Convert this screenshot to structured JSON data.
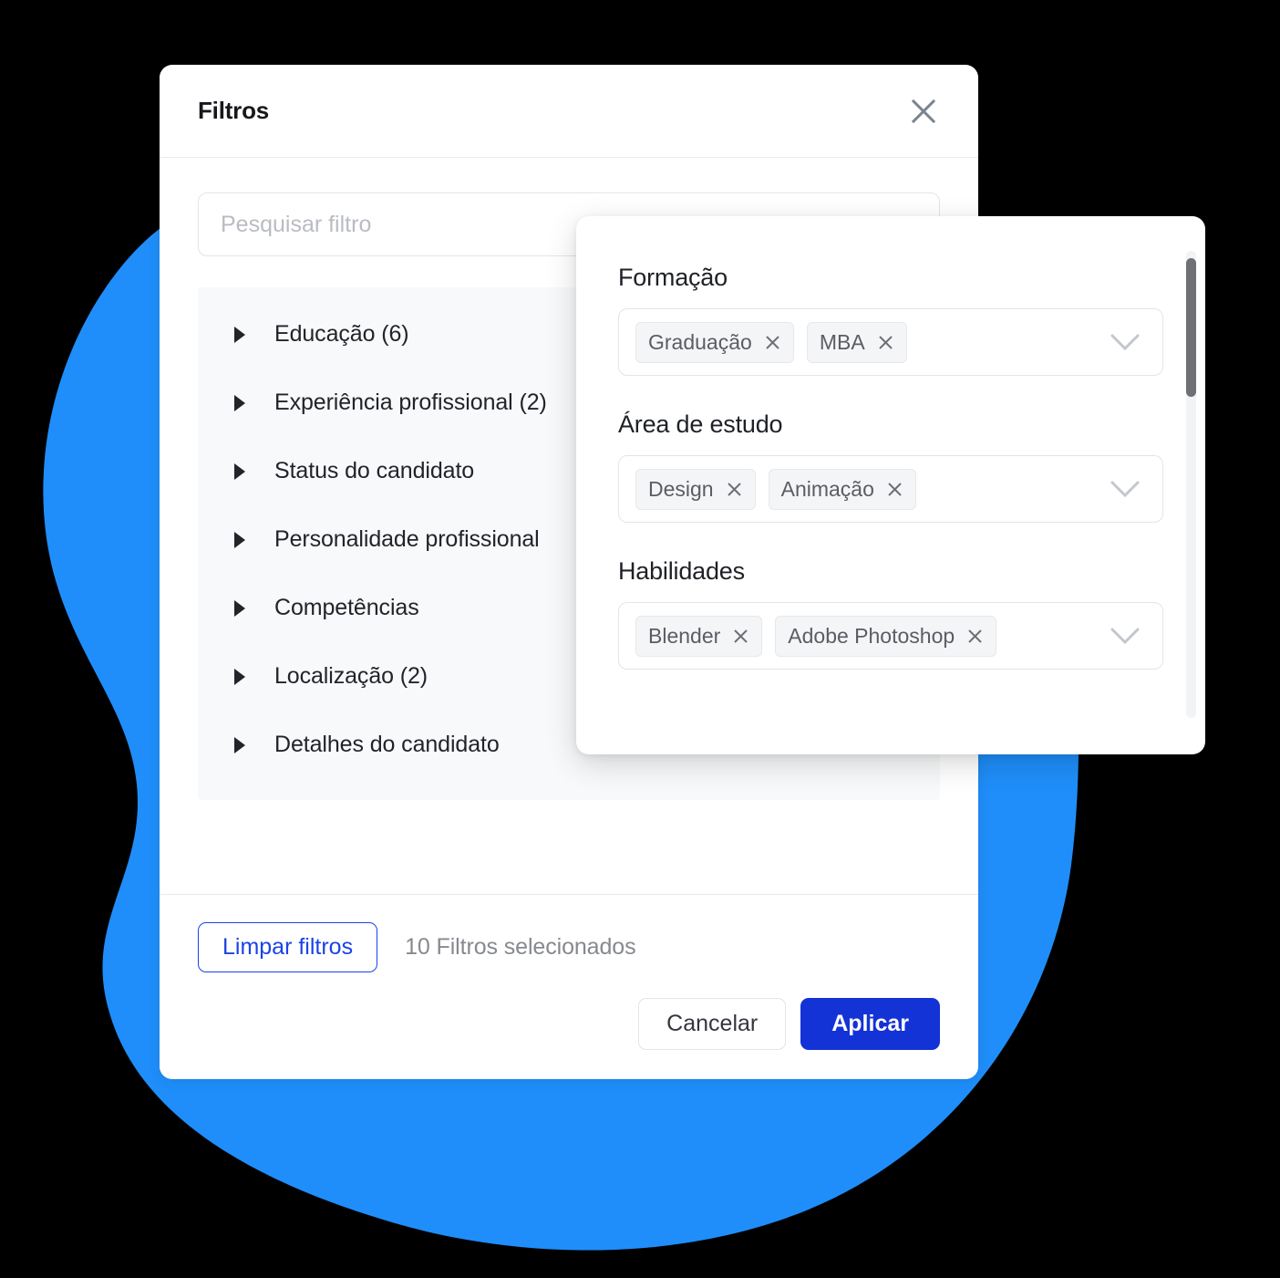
{
  "modal": {
    "title": "Filtros",
    "close_icon": "close-x-icon",
    "search": {
      "placeholder": "Pesquisar filtro",
      "value": ""
    },
    "filter_groups": [
      {
        "label": "Educação (6)",
        "caret": "caret-right-icon"
      },
      {
        "label": "Experiência profissional (2)",
        "caret": "caret-right-icon"
      },
      {
        "label": "Status do candidato",
        "caret": "caret-right-icon"
      },
      {
        "label": "Personalidade profissional",
        "caret": "caret-right-icon"
      },
      {
        "label": "Competências",
        "caret": "caret-right-icon"
      },
      {
        "label": "Localização (2)",
        "caret": "caret-right-icon"
      },
      {
        "label": "Detalhes do candidato",
        "caret": "caret-right-icon"
      }
    ],
    "footer": {
      "clear_label": "Limpar filtros",
      "selected_text": "10 Filtros selecionados",
      "cancel_label": "Cancelar",
      "apply_label": "Aplicar"
    }
  },
  "detail_panel": {
    "fields": [
      {
        "label": "Formação",
        "chips": [
          "Graduação",
          "MBA"
        ],
        "chevron": "chevron-down-icon"
      },
      {
        "label": "Área de estudo",
        "chips": [
          "Design",
          "Animação"
        ],
        "chevron": "chevron-down-icon"
      },
      {
        "label": "Habilidades",
        "chips": [
          "Blender",
          "Adobe Photoshop"
        ],
        "chevron": "chevron-down-icon"
      }
    ],
    "scrollbar": "vertical-scrollbar"
  },
  "colors": {
    "page_background": "#000000",
    "blob_blue": "#1f8efa",
    "accent_blue": "#1433d6",
    "link_blue": "#1a43e8",
    "chip_background": "#f4f5f7",
    "list_background": "#f8f9fa",
    "muted_text": "#86898f"
  }
}
